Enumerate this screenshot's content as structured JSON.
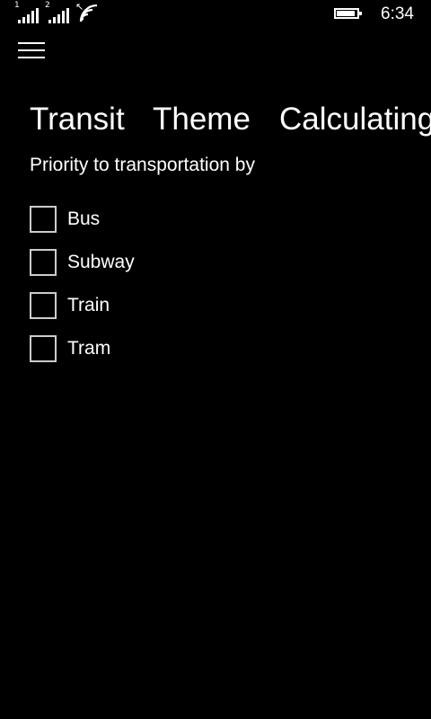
{
  "status_bar": {
    "sim1_label": "1",
    "sim2_label": "2",
    "sim1_signal": 1.0,
    "sim2_signal": 1.0,
    "battery_level": 0.9,
    "time": "6:34"
  },
  "header": {
    "menu_icon": "hamburger-menu-icon"
  },
  "tabs": [
    {
      "label": "Transit"
    },
    {
      "label": "Theme"
    },
    {
      "label": "Calculating"
    }
  ],
  "section": {
    "title": "Priority to transportation by"
  },
  "options": [
    {
      "label": "Bus",
      "checked": false
    },
    {
      "label": "Subway",
      "checked": false
    },
    {
      "label": "Train",
      "checked": false
    },
    {
      "label": "Tram",
      "checked": false
    }
  ],
  "colors": {
    "background": "#000000",
    "foreground": "#ffffff",
    "checkbox_border": "#cccccc"
  }
}
